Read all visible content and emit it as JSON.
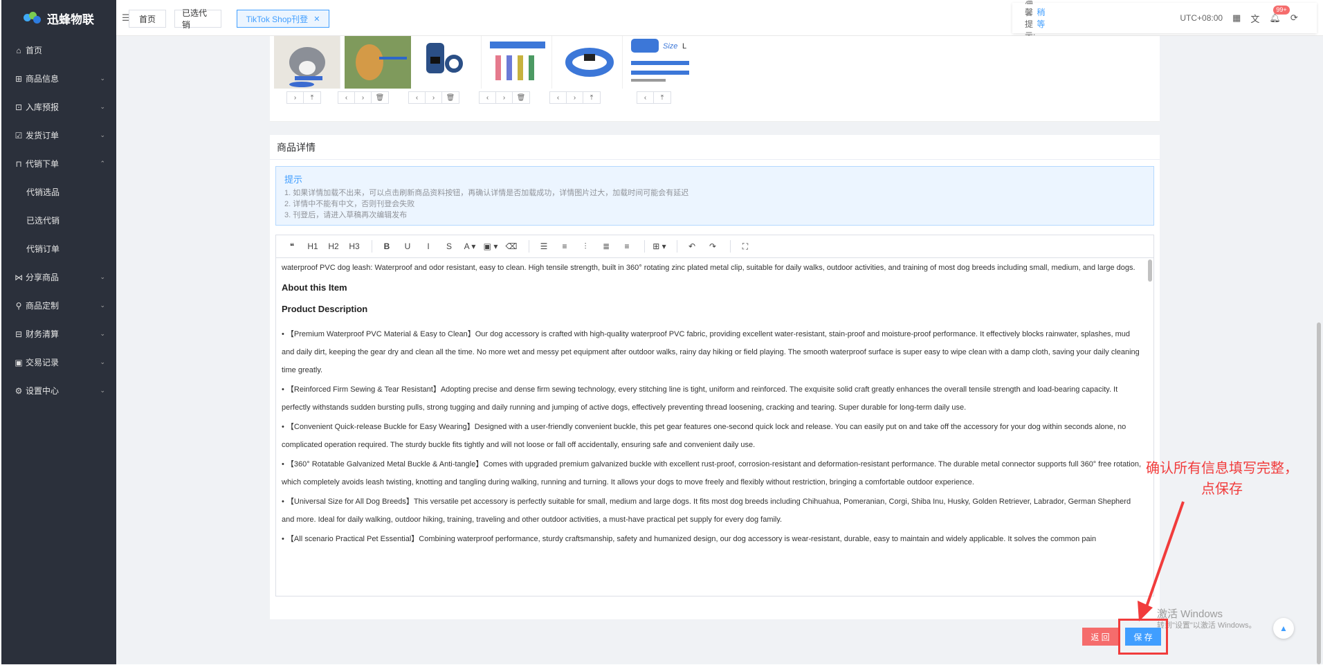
{
  "app": {
    "logo_text": "迅蜂物联"
  },
  "sidebar": {
    "items": [
      {
        "icon": "home-icon",
        "glyph": "⌂",
        "label": "首页",
        "arrow": ""
      },
      {
        "icon": "gift-icon",
        "glyph": "⊞",
        "label": "商品信息",
        "arrow": "⌄"
      },
      {
        "icon": "inbound-icon",
        "glyph": "⊡",
        "label": "入库预报",
        "arrow": "⌄"
      },
      {
        "icon": "shipping-order-icon",
        "glyph": "☑",
        "label": "发货订单",
        "arrow": "⌄"
      },
      {
        "icon": "cart-icon",
        "glyph": "⊓",
        "label": "代销下单",
        "arrow": "⌃"
      },
      {
        "icon": "",
        "glyph": "",
        "label": "代销选品",
        "arrow": "",
        "sub": true
      },
      {
        "icon": "",
        "glyph": "",
        "label": "已选代销",
        "arrow": "",
        "sub": true
      },
      {
        "icon": "",
        "glyph": "",
        "label": "代销订单",
        "arrow": "",
        "sub": true
      },
      {
        "icon": "share-icon",
        "glyph": "⋈",
        "label": "分享商品",
        "arrow": "⌄"
      },
      {
        "icon": "customize-icon",
        "glyph": "⚲",
        "label": "商品定制",
        "arrow": "⌄"
      },
      {
        "icon": "finance-icon",
        "glyph": "⊟",
        "label": "财务清算",
        "arrow": "⌄"
      },
      {
        "icon": "transaction-icon",
        "glyph": "▣",
        "label": "交易记录",
        "arrow": "⌄"
      },
      {
        "icon": "settings-icon",
        "glyph": "⚙",
        "label": "设置中心",
        "arrow": "⌄"
      }
    ]
  },
  "header": {
    "tab_toggle": "☰",
    "tabs": [
      {
        "label": "首页",
        "closable": false
      },
      {
        "label": "已选代销",
        "closable": false
      },
      {
        "label": "TikTok Shop刊登",
        "closable": true,
        "active": true
      }
    ],
    "tip_label": "温馨提示:",
    "tip_link": "稍等",
    "timezone": "UTC+08:00",
    "notification_count": "99+"
  },
  "images_card": {
    "controls": [
      [
        "›",
        "⤒"
      ],
      [
        "‹",
        "›",
        "🗑"
      ],
      [
        "‹",
        "›",
        "🗑"
      ],
      [
        "‹",
        "›",
        "🗑"
      ],
      [
        "‹",
        "›",
        "⤒"
      ],
      [
        "‹",
        "⤒"
      ]
    ],
    "size_label": "Size",
    "size_value": "L"
  },
  "detail_card": {
    "title": "商品详情",
    "alert_title": "提示",
    "alert_lines": [
      "1. 如果详情加载不出来，可以点击刷新商品资料按钮，再确认详情是否加载成功，详情图片过大，加载时间可能会有延迟",
      "2. 详情中不能有中文，否则刊登会失败",
      "3. 刊登后，请进入草稿再次编辑发布"
    ],
    "toolbar": [
      "❝",
      "H1",
      "H2",
      "H3",
      "B",
      "U",
      "I",
      "S",
      "A ▾",
      "▣ ▾",
      "⌫",
      "☰",
      "≡",
      "⫶",
      "≣",
      "≡",
      "⊞ ▾",
      "↶",
      "↷",
      "⛶"
    ],
    "editor": {
      "intro": "waterproof PVC dog leash: Waterproof and odor resistant, easy to clean. High tensile strength, built in 360° rotating zinc plated metal clip, suitable for daily walks, outdoor activities, and training of most dog breeds including small, medium, and large dogs.",
      "heading1": "About this Item",
      "heading2": "Product Description",
      "bullets": [
        "• 【Premium Waterproof PVC Material & Easy to Clean】Our dog accessory is crafted with high-quality waterproof PVC fabric, providing excellent water-resistant, stain-proof and moisture-proof performance. It effectively blocks rainwater, splashes, mud and daily dirt, keeping the gear dry and clean all the time. No more wet and messy pet equipment after outdoor walks, rainy day hiking or field playing. The smooth waterproof surface is super easy to wipe clean with a damp cloth, saving your daily cleaning time greatly.",
        "• 【Reinforced Firm Sewing & Tear Resistant】Adopting precise and dense firm sewing technology, every stitching line is tight, uniform and reinforced. The exquisite solid craft greatly enhances the overall tensile strength and load-bearing capacity. It perfectly withstands sudden bursting pulls, strong tugging and daily running and jumping of active dogs, effectively preventing thread loosening, cracking and tearing. Super durable for long-term daily use.",
        "• 【Convenient Quick-release Buckle for Easy Wearing】Designed with a user-friendly convenient buckle, this pet gear features one-second quick lock and release. You can easily put on and take off the accessory for your dog within seconds alone, no complicated operation required. The sturdy buckle fits tightly and will not loose or fall off accidentally, ensuring safe and convenient daily use.",
        "• 【360° Rotatable Galvanized Metal Buckle & Anti-tangle】Comes with upgraded premium galvanized buckle with excellent rust-proof, corrosion-resistant and deformation-resistant performance. The durable metal connector supports full 360° free rotation, which completely avoids leash twisting, knotting and tangling during walking, running and turning. It allows your dogs to move freely and flexibly without restriction, bringing a comfortable outdoor experience.",
        "• 【Universal Size for All Dog Breeds】This versatile pet accessory is perfectly suitable for small, medium and large dogs. It fits most dog breeds including Chihuahua, Pomeranian, Corgi, Shiba Inu, Husky, Golden Retriever, Labrador, German Shepherd and more. Ideal for daily walking, outdoor hiking, training, traveling and other outdoor activities, a must-have practical pet supply for every dog family.",
        "• 【All scenario Practical Pet Essential】Combining waterproof performance, sturdy craftsmanship, safety and humanized design, our dog accessory is wear-resistant, durable, easy to maintain and widely applicable. It solves the common pain"
      ]
    }
  },
  "actions": {
    "back_label": "返 回",
    "save_label": "保 存"
  },
  "annotation": {
    "line1": "确认所有信息填写完整，",
    "line2": "点保存"
  },
  "watermark": {
    "line1": "激活 Windows",
    "line2": "转到\"设置\"以激活 Windows。"
  },
  "colors": {
    "sidebar_bg": "#2b303b",
    "primary": "#409eff",
    "danger": "#f56c6c",
    "annotation": "#f13c3c"
  }
}
